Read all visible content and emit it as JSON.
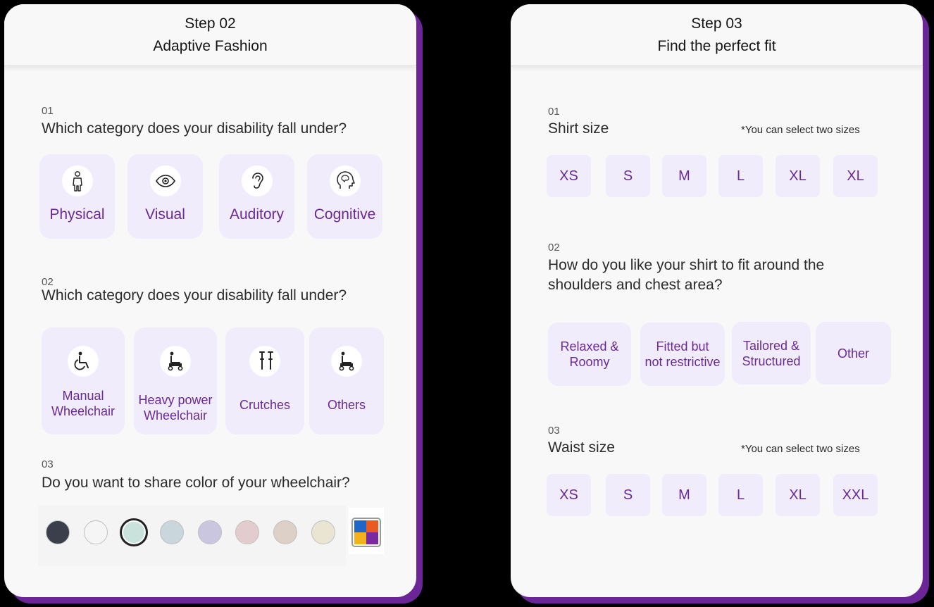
{
  "left": {
    "step": "Step 02",
    "title": "Adaptive Fashion",
    "q1": {
      "num": "01",
      "text": "Which category does your disability fall under?",
      "options": [
        {
          "label": "Physical",
          "icon": "person-icon"
        },
        {
          "label": "Visual",
          "icon": "eye-icon"
        },
        {
          "label": "Auditory",
          "icon": "ear-icon"
        },
        {
          "label": "Cognitive",
          "icon": "brain-head-icon"
        }
      ]
    },
    "q2": {
      "num": "02",
      "text": "Which category does your disability fall under?",
      "options": [
        {
          "line1": "Manual",
          "line2": "Wheelchair",
          "icon": "manual-wheelchair-icon"
        },
        {
          "line1": "Heavy power",
          "line2": "Wheelchair",
          "icon": "power-wheelchair-icon"
        },
        {
          "label": "Crutches",
          "icon": "crutches-icon"
        },
        {
          "label": "Others",
          "icon": "wheelchair-other-icon"
        }
      ]
    },
    "q3": {
      "num": "03",
      "text": "Do you want to share color of your wheelchair?",
      "colors": [
        "#3a3f4b",
        "#f5f5f5",
        "#c9e3dc",
        "#c9d7dd",
        "#cbc6df",
        "#e3cccd",
        "#ddd0c6",
        "#e9e5d2"
      ],
      "selected_index": 2,
      "palette_icon": "color-palette-icon",
      "palette_colors": [
        "#1f66c9",
        "#ea5a1f",
        "#f2b21c",
        "#7a2aa1"
      ]
    }
  },
  "right": {
    "step": "Step 03",
    "title": "Find the perfect fit",
    "q1": {
      "num": "01",
      "text": "Shirt size",
      "note": "*You can select two sizes",
      "sizes": [
        "XS",
        "S",
        "M",
        "L",
        "XL",
        "XL"
      ]
    },
    "q2": {
      "num": "02",
      "line1": "How do you like your shirt to fit around the",
      "line2": "shoulders and chest area?",
      "options": [
        {
          "line1": "Relaxed &",
          "line2": "Roomy"
        },
        {
          "line1": "Fitted but",
          "line2": "not restrictive"
        },
        {
          "line1": "Tailored &",
          "line2": "Structured"
        },
        {
          "line1": "Other",
          "line2": ""
        }
      ]
    },
    "q3": {
      "num": "03",
      "text": "Waist size",
      "note": "*You can select two sizes",
      "sizes": [
        "XS",
        "S",
        "M",
        "L",
        "XL",
        "XXL"
      ]
    }
  },
  "colors": {
    "accent": "#6a2a93",
    "tile_bg": "#f0ecfb",
    "card_shadow": "#6b2597"
  }
}
